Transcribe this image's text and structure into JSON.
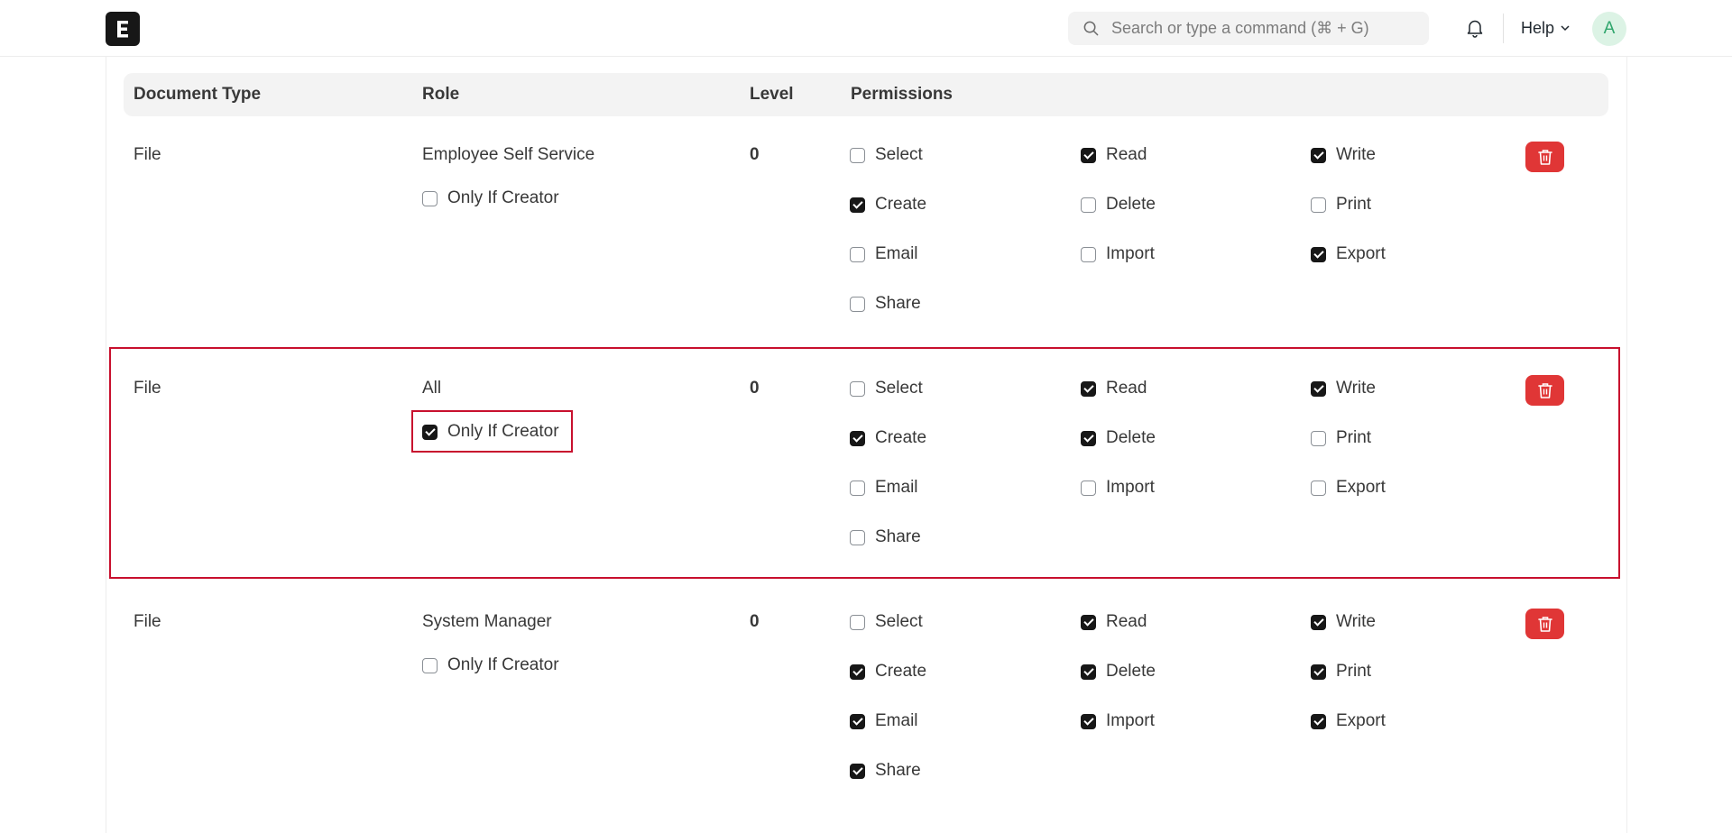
{
  "navbar": {
    "logo_icon": "frappe-logo-icon",
    "search_placeholder": "Search or type a command (⌘ + G)",
    "notifications_icon": "bell-icon",
    "help_label": "Help",
    "avatar_initial": "A"
  },
  "table": {
    "headers": {
      "document_type": "Document Type",
      "role": "Role",
      "level": "Level",
      "permissions": "Permissions"
    },
    "rows": [
      {
        "document_type": "File",
        "role": "Employee Self Service",
        "only_if_creator": {
          "label": "Only If Creator",
          "checked": false
        },
        "level": "0",
        "permissions": [
          {
            "label": "Select",
            "checked": false
          },
          {
            "label": "Read",
            "checked": true
          },
          {
            "label": "Write",
            "checked": true
          },
          {
            "label": "Create",
            "checked": true
          },
          {
            "label": "Delete",
            "checked": false
          },
          {
            "label": "Print",
            "checked": false
          },
          {
            "label": "Email",
            "checked": false
          },
          {
            "label": "Import",
            "checked": false
          },
          {
            "label": "Export",
            "checked": true
          },
          {
            "label": "Share",
            "checked": false
          }
        ]
      },
      {
        "document_type": "File",
        "role": "All",
        "only_if_creator": {
          "label": "Only If Creator",
          "checked": true
        },
        "level": "0",
        "permissions": [
          {
            "label": "Select",
            "checked": false
          },
          {
            "label": "Read",
            "checked": true
          },
          {
            "label": "Write",
            "checked": true
          },
          {
            "label": "Create",
            "checked": true
          },
          {
            "label": "Delete",
            "checked": true
          },
          {
            "label": "Print",
            "checked": false
          },
          {
            "label": "Email",
            "checked": false
          },
          {
            "label": "Import",
            "checked": false
          },
          {
            "label": "Export",
            "checked": false
          },
          {
            "label": "Share",
            "checked": false
          }
        ]
      },
      {
        "document_type": "File",
        "role": "System Manager",
        "only_if_creator": {
          "label": "Only If Creator",
          "checked": false
        },
        "level": "0",
        "permissions": [
          {
            "label": "Select",
            "checked": false
          },
          {
            "label": "Read",
            "checked": true
          },
          {
            "label": "Write",
            "checked": true
          },
          {
            "label": "Create",
            "checked": true
          },
          {
            "label": "Delete",
            "checked": true
          },
          {
            "label": "Print",
            "checked": true
          },
          {
            "label": "Email",
            "checked": true
          },
          {
            "label": "Import",
            "checked": true
          },
          {
            "label": "Export",
            "checked": true
          },
          {
            "label": "Share",
            "checked": true
          }
        ]
      }
    ]
  },
  "colors": {
    "delete_button": "#e03636",
    "highlight": "#c8102e",
    "checkbox_checked": "#171717",
    "avatar_bg": "#dcf3e5",
    "avatar_text": "#30a66d"
  }
}
